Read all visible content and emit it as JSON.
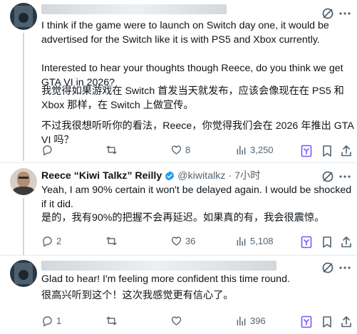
{
  "tweet1": {
    "text_en": "I think if the game were to launch on Switch day one, it would be advertised for the Switch like it is with PS5 and Xbox currently.\n\nInterested to hear your thoughts though Reece, do you think we get GTA VI in 2026?",
    "text_zh_1": "我觉得如果游戏在 Switch 首发当天就发布，应该会像现在在 PS5 和 Xbox 那样，在 Switch 上做宣传。",
    "text_zh_2": "不过我很想听听你的看法，Reece，你觉得我们会在 2026 年推出 GTA VI 吗？",
    "replies": "",
    "retweets": "",
    "likes": "8",
    "views": "3,250"
  },
  "tweet2": {
    "name": "Reece “Kiwi Talkz” Reilly",
    "handle": "@kiwitalkz",
    "time": "· 7小时",
    "text_en": "Yeah, I am 90% certain it won't be delayed again. I would be shocked if it did.",
    "text_zh": "是的，我有90%的把握不会再延迟。如果真的有，我会很震惊。",
    "replies": "2",
    "retweets": "",
    "likes": "36",
    "views": "5,108"
  },
  "tweet3": {
    "text_en": "Glad to hear! I'm feeling more confident this time round.",
    "text_zh": "很高兴听到这个！这次我感觉更有信心了。",
    "replies": "1",
    "retweets": "",
    "likes": "",
    "views": "396"
  },
  "colors": {
    "verified": "#1d9bf0",
    "text": "#0f1419",
    "muted": "#536471",
    "grok": "#7856ff"
  }
}
